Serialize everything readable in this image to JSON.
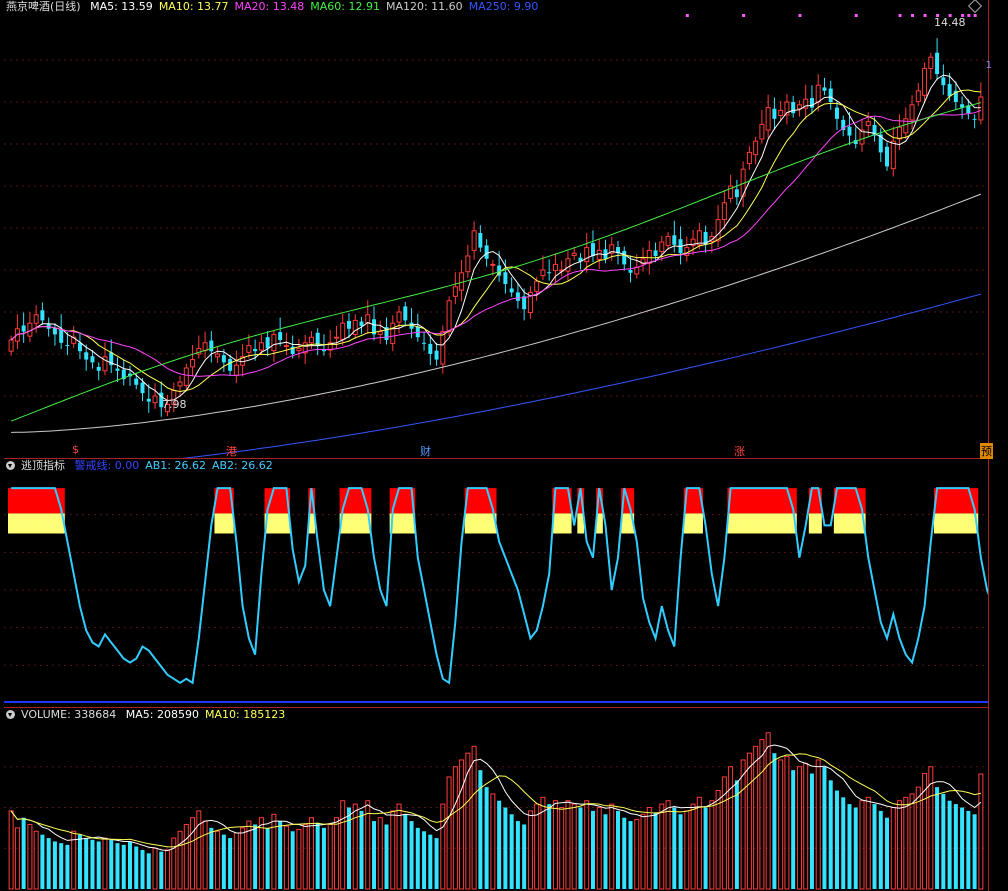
{
  "main": {
    "title": "燕京啤酒(日线)",
    "ma": [
      {
        "label": "MA5: 13.59",
        "color": "#ffffff"
      },
      {
        "label": "MA10: 13.77",
        "color": "#ffff55"
      },
      {
        "label": "MA20: 13.48",
        "color": "#ff44ff"
      },
      {
        "label": "MA60: 12.91",
        "color": "#44ee44"
      },
      {
        "label": "MA120: 11.60",
        "color": "#cccccc"
      },
      {
        "label": "MA250: 9.90",
        "color": "#3355ff"
      }
    ],
    "high_label": "14.48",
    "low_label": "7.98",
    "right_tag": "1",
    "events": [
      {
        "label": "$",
        "style": ""
      },
      {
        "label": "港",
        "style": ""
      },
      {
        "label": "财",
        "style": "blue"
      },
      {
        "label": "涨",
        "style": ""
      },
      {
        "label": "预",
        "style": "box"
      }
    ]
  },
  "indicator": {
    "title": "逃顶指标",
    "lines": [
      {
        "label": "警戒线: 0.00",
        "color": "#3344ff"
      },
      {
        "label": "AB1: 26.62",
        "color": "#44ccff"
      },
      {
        "label": "AB2: 26.62",
        "color": "#44ccff"
      }
    ]
  },
  "volume": {
    "title": "VOLUME: 338684",
    "lines": [
      {
        "label": "MA5: 208590",
        "color": "#ffffff"
      },
      {
        "label": "MA10: 185123",
        "color": "#ffff55"
      }
    ]
  },
  "chart_data": {
    "type": "candlestick",
    "title": "燕京啤酒(日线)",
    "ylim": [
      7.5,
      15.0
    ],
    "close": [
      9.25,
      9.45,
      9.4,
      9.55,
      9.7,
      9.6,
      9.45,
      9.35,
      9.2,
      9.15,
      9.3,
      9.05,
      8.9,
      8.85,
      8.7,
      8.95,
      8.8,
      8.7,
      8.55,
      8.6,
      8.45,
      8.3,
      8.15,
      8.25,
      8.05,
      8.1,
      8.35,
      8.5,
      8.75,
      8.9,
      9.1,
      9.2,
      9.05,
      9.0,
      8.85,
      8.7,
      8.8,
      8.95,
      9.15,
      9.05,
      9.2,
      9.1,
      9.35,
      9.25,
      9.15,
      9.0,
      9.1,
      9.2,
      9.3,
      9.15,
      9.05,
      9.2,
      9.3,
      9.55,
      9.45,
      9.6,
      9.5,
      9.7,
      9.35,
      9.4,
      9.25,
      9.55,
      9.75,
      9.6,
      9.45,
      9.3,
      9.2,
      9.0,
      8.9,
      9.4,
      9.95,
      10.2,
      10.45,
      10.75,
      11.2,
      10.9,
      10.7,
      10.6,
      10.4,
      10.25,
      10.1,
      9.95,
      9.8,
      10.1,
      10.3,
      10.5,
      10.45,
      10.6,
      10.5,
      10.7,
      10.8,
      10.65,
      10.9,
      10.75,
      10.85,
      10.7,
      10.95,
      10.8,
      10.6,
      10.45,
      10.55,
      10.7,
      10.85,
      10.75,
      11.0,
      11.1,
      10.95,
      10.8,
      10.9,
      11.05,
      11.2,
      10.95,
      11.1,
      11.4,
      11.7,
      12.0,
      11.8,
      12.3,
      12.6,
      12.8,
      13.1,
      13.4,
      13.2,
      13.35,
      13.5,
      13.3,
      13.45,
      13.55,
      13.4,
      13.8,
      13.7,
      13.5,
      13.2,
      13.0,
      12.9,
      12.75,
      13.0,
      13.15,
      12.9,
      12.6,
      12.35,
      12.8,
      13.05,
      13.2,
      13.45,
      13.7,
      14.1,
      14.3,
      14.0,
      13.8,
      13.6,
      13.5,
      13.4,
      13.3,
      13.2,
      13.59
    ],
    "volume": [
      230000,
      180000,
      210000,
      190000,
      170000,
      160000,
      150000,
      140000,
      135000,
      130000,
      170000,
      160000,
      150000,
      145000,
      140000,
      150000,
      145000,
      135000,
      130000,
      140000,
      125000,
      115000,
      105000,
      120000,
      110000,
      115000,
      150000,
      170000,
      190000,
      210000,
      230000,
      200000,
      180000,
      170000,
      160000,
      150000,
      165000,
      180000,
      200000,
      190000,
      210000,
      180000,
      220000,
      200000,
      185000,
      170000,
      175000,
      190000,
      210000,
      195000,
      180000,
      190000,
      210000,
      260000,
      240000,
      250000,
      230000,
      260000,
      200000,
      210000,
      190000,
      230000,
      250000,
      220000,
      200000,
      180000,
      170000,
      160000,
      150000,
      250000,
      330000,
      360000,
      380000,
      400000,
      420000,
      350000,
      300000,
      280000,
      260000,
      240000,
      220000,
      200000,
      190000,
      230000,
      250000,
      270000,
      250000,
      260000,
      240000,
      260000,
      250000,
      240000,
      260000,
      230000,
      240000,
      220000,
      250000,
      230000,
      210000,
      200000,
      205000,
      220000,
      240000,
      225000,
      250000,
      260000,
      240000,
      220000,
      230000,
      250000,
      270000,
      240000,
      260000,
      290000,
      330000,
      360000,
      320000,
      380000,
      400000,
      420000,
      440000,
      460000,
      400000,
      380000,
      390000,
      350000,
      360000,
      370000,
      340000,
      380000,
      360000,
      320000,
      290000,
      270000,
      250000,
      240000,
      260000,
      270000,
      250000,
      230000,
      210000,
      240000,
      260000,
      270000,
      280000,
      300000,
      340000,
      360000,
      300000,
      280000,
      260000,
      250000,
      240000,
      230000,
      220000,
      338684
    ],
    "indicator_ab1": [
      26.62,
      26.62,
      26.62,
      26.62,
      26.62,
      26.62,
      26.62,
      26.62,
      24.0,
      20.0,
      16.0,
      12.0,
      9.0,
      7.5,
      7.0,
      8.5,
      7.5,
      6.5,
      5.5,
      5.0,
      5.5,
      7.0,
      6.5,
      5.5,
      4.5,
      3.5,
      3.0,
      2.5,
      3.0,
      2.5,
      8.0,
      15.0,
      22.0,
      26.62,
      26.62,
      26.62,
      20.0,
      12.0,
      8.0,
      6.0,
      16.0,
      24.0,
      26.62,
      26.62,
      26.62,
      19.0,
      15.0,
      17.0,
      26.62,
      20.0,
      14.0,
      12.0,
      18.0,
      24.0,
      26.62,
      26.62,
      26.62,
      24.0,
      18.0,
      14.0,
      12.0,
      24.0,
      26.62,
      26.62,
      26.62,
      18.0,
      14.0,
      10.0,
      6.0,
      3.0,
      2.5,
      10.0,
      20.0,
      26.62,
      26.62,
      26.62,
      26.62,
      24.0,
      20.0,
      18.0,
      16.0,
      14.0,
      11.0,
      8.0,
      9.0,
      12.0,
      16.0,
      26.62,
      26.62,
      26.62,
      22.0,
      26.62,
      20.0,
      18.0,
      26.62,
      22.0,
      14.0,
      18.0,
      26.62,
      24.0,
      20.0,
      13.0,
      10.0,
      8.0,
      12.0,
      9.0,
      7.0,
      18.0,
      26.62,
      26.62,
      26.62,
      22.0,
      16.0,
      12.0,
      18.0,
      26.62,
      26.62,
      26.62,
      26.62,
      26.62,
      26.62,
      26.62,
      26.62,
      26.62,
      26.62,
      24.0,
      18.0,
      22.0,
      26.62,
      26.62,
      22.0,
      22.0,
      26.62,
      26.62,
      26.62,
      26.62,
      24.0,
      18.0,
      14.0,
      10.0,
      8.0,
      11.0,
      8.0,
      6.0,
      5.0,
      8.0,
      12.0,
      20.0,
      26.62,
      26.62,
      26.62,
      26.62,
      26.62,
      26.62,
      24.0,
      18.0,
      14.0,
      12.0,
      16.0,
      10.0,
      26.62
    ],
    "indicator_ab2": 26.62,
    "warning_line": 0.0
  }
}
